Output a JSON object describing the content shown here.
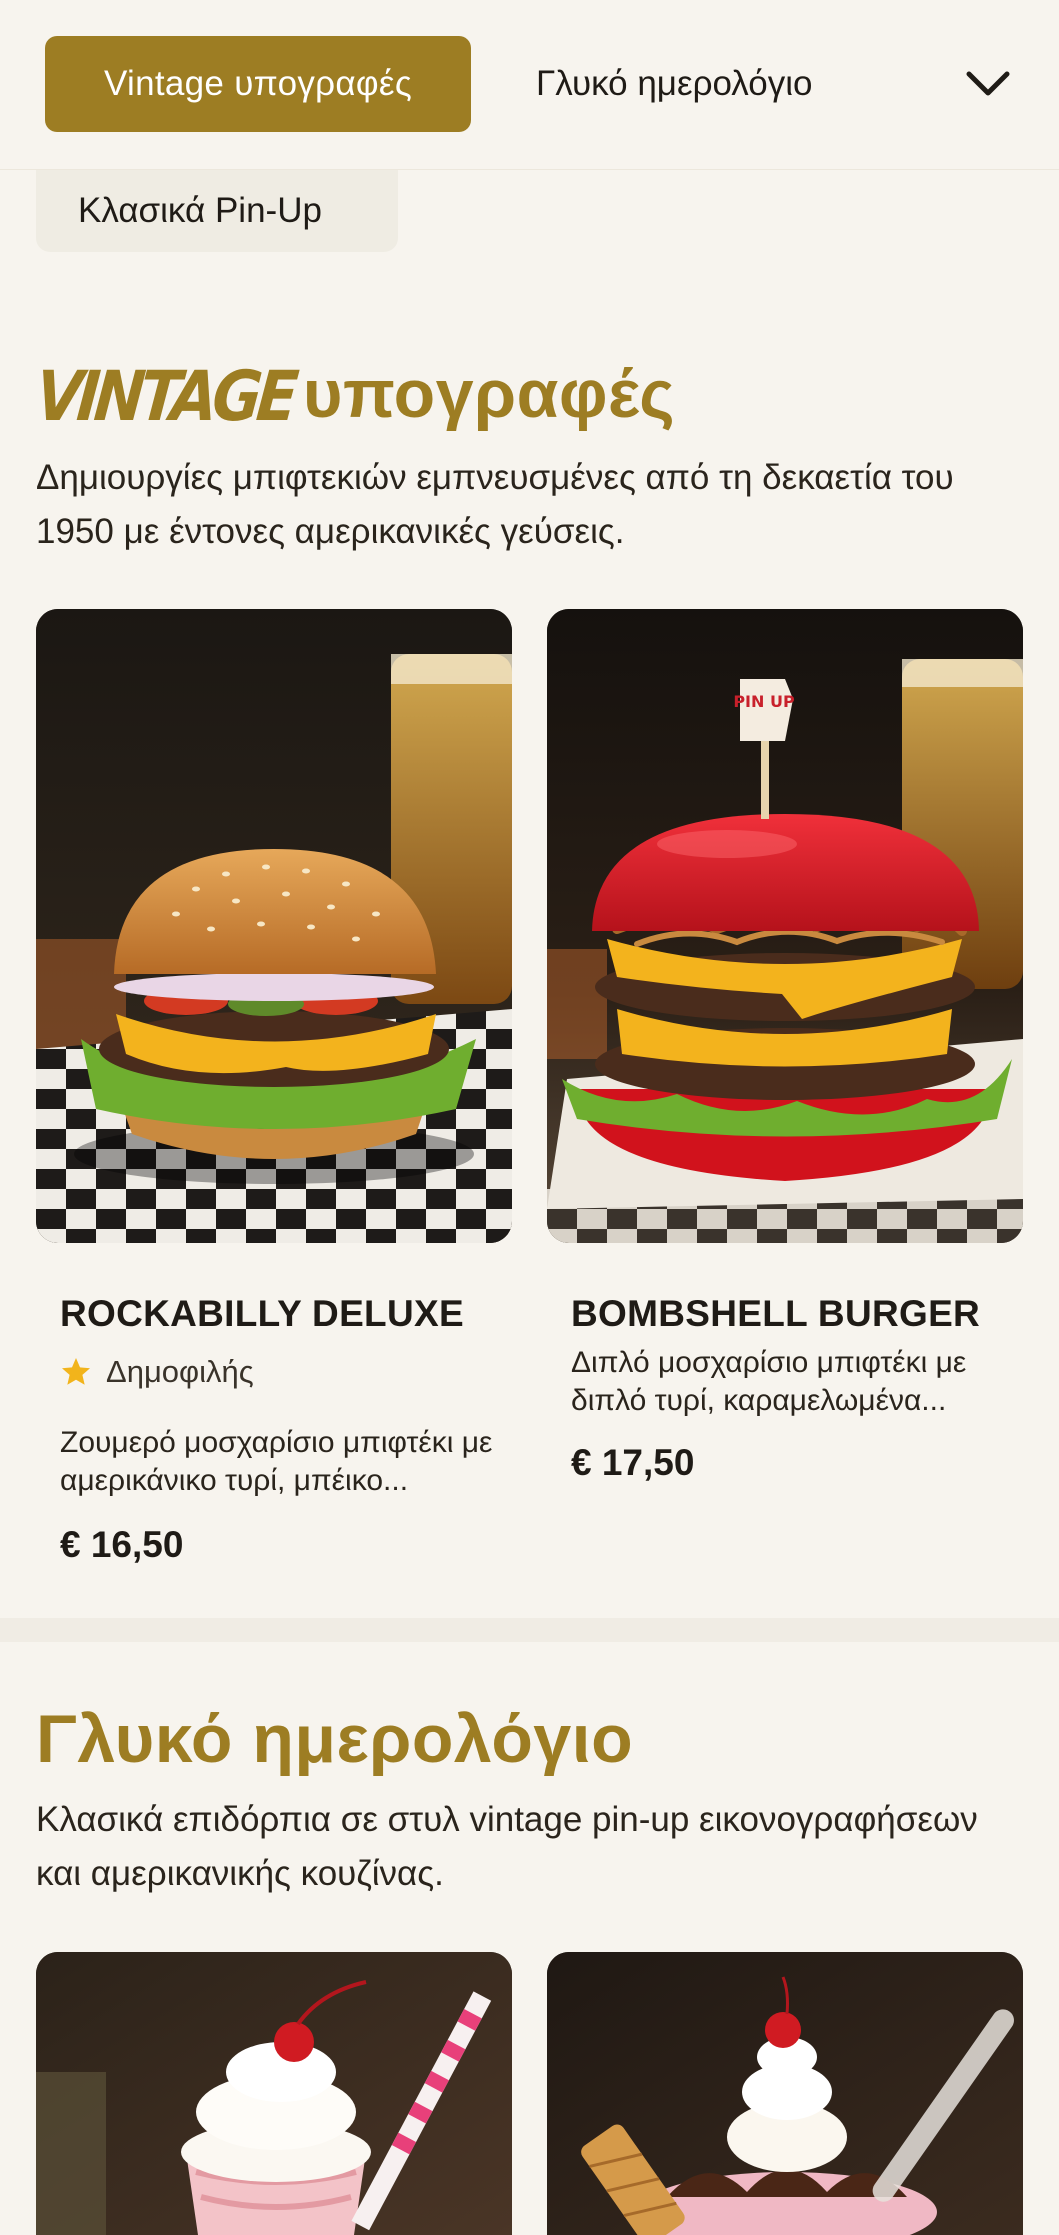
{
  "nav": {
    "active_tab": "Vintage υπογραφές",
    "tab_2": "Γλυκό ημερολόγιο",
    "tab_3": "Κλασικά Pin-Up"
  },
  "sections": [
    {
      "title_stylized": "VINTAGE",
      "title_rest": "υπογραφές",
      "description": "Δημιουργίες μπιφτεκιών εμπνευσμένες από τη δεκαετία του 1950 με έντονες αμερικανικές γεύσεις.",
      "items": [
        {
          "name": "ROCKABILLY DELUXE",
          "badge": "Δημοφιλής",
          "description": "Ζουμερό μοσχαρίσιο μπιφτέκι με αμερικάνικο τυρί, μπέικο...",
          "price": "€ 16,50"
        },
        {
          "name": "BOMBSHELL BURGER",
          "description": "Διπλό μοσχαρίσιο μπιφτέκι με διπλό τυρί, καραμελωμένα...",
          "price": "€ 17,50",
          "flag_text": "PIN UP"
        }
      ]
    },
    {
      "title": "Γλυκό ημερολόγιο",
      "description": "Κλασικά επιδόρπια σε στυλ vintage pin-up εικονογραφήσεων και αμερικανικής κουζίνας."
    }
  ],
  "colors": {
    "accent": "#9d7d23",
    "background": "#f7f4ee",
    "chip_bg": "#efece3",
    "star": "#f2b41b"
  },
  "icons": [
    "chevron-down-icon",
    "star-icon"
  ]
}
